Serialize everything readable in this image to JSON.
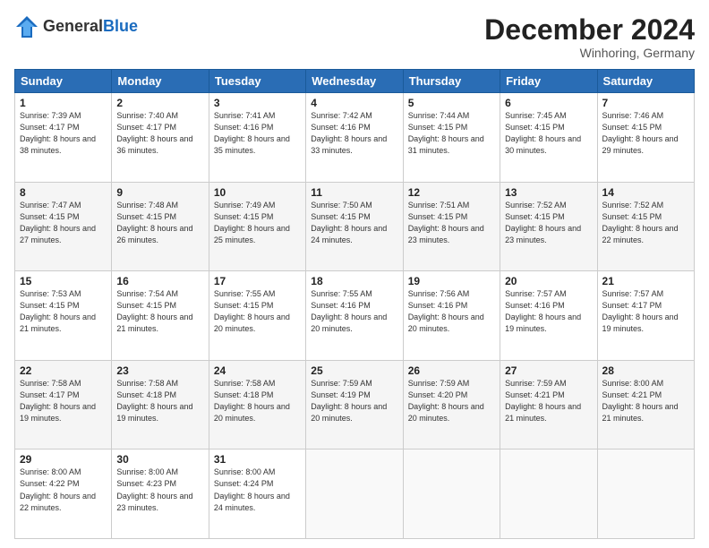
{
  "header": {
    "logo_general": "General",
    "logo_blue": "Blue",
    "month_title": "December 2024",
    "location": "Winhoring, Germany"
  },
  "weekdays": [
    "Sunday",
    "Monday",
    "Tuesday",
    "Wednesday",
    "Thursday",
    "Friday",
    "Saturday"
  ],
  "weeks": [
    [
      {
        "day": "1",
        "sunrise": "Sunrise: 7:39 AM",
        "sunset": "Sunset: 4:17 PM",
        "daylight": "Daylight: 8 hours and 38 minutes."
      },
      {
        "day": "2",
        "sunrise": "Sunrise: 7:40 AM",
        "sunset": "Sunset: 4:17 PM",
        "daylight": "Daylight: 8 hours and 36 minutes."
      },
      {
        "day": "3",
        "sunrise": "Sunrise: 7:41 AM",
        "sunset": "Sunset: 4:16 PM",
        "daylight": "Daylight: 8 hours and 35 minutes."
      },
      {
        "day": "4",
        "sunrise": "Sunrise: 7:42 AM",
        "sunset": "Sunset: 4:16 PM",
        "daylight": "Daylight: 8 hours and 33 minutes."
      },
      {
        "day": "5",
        "sunrise": "Sunrise: 7:44 AM",
        "sunset": "Sunset: 4:15 PM",
        "daylight": "Daylight: 8 hours and 31 minutes."
      },
      {
        "day": "6",
        "sunrise": "Sunrise: 7:45 AM",
        "sunset": "Sunset: 4:15 PM",
        "daylight": "Daylight: 8 hours and 30 minutes."
      },
      {
        "day": "7",
        "sunrise": "Sunrise: 7:46 AM",
        "sunset": "Sunset: 4:15 PM",
        "daylight": "Daylight: 8 hours and 29 minutes."
      }
    ],
    [
      {
        "day": "8",
        "sunrise": "Sunrise: 7:47 AM",
        "sunset": "Sunset: 4:15 PM",
        "daylight": "Daylight: 8 hours and 27 minutes."
      },
      {
        "day": "9",
        "sunrise": "Sunrise: 7:48 AM",
        "sunset": "Sunset: 4:15 PM",
        "daylight": "Daylight: 8 hours and 26 minutes."
      },
      {
        "day": "10",
        "sunrise": "Sunrise: 7:49 AM",
        "sunset": "Sunset: 4:15 PM",
        "daylight": "Daylight: 8 hours and 25 minutes."
      },
      {
        "day": "11",
        "sunrise": "Sunrise: 7:50 AM",
        "sunset": "Sunset: 4:15 PM",
        "daylight": "Daylight: 8 hours and 24 minutes."
      },
      {
        "day": "12",
        "sunrise": "Sunrise: 7:51 AM",
        "sunset": "Sunset: 4:15 PM",
        "daylight": "Daylight: 8 hours and 23 minutes."
      },
      {
        "day": "13",
        "sunrise": "Sunrise: 7:52 AM",
        "sunset": "Sunset: 4:15 PM",
        "daylight": "Daylight: 8 hours and 23 minutes."
      },
      {
        "day": "14",
        "sunrise": "Sunrise: 7:52 AM",
        "sunset": "Sunset: 4:15 PM",
        "daylight": "Daylight: 8 hours and 22 minutes."
      }
    ],
    [
      {
        "day": "15",
        "sunrise": "Sunrise: 7:53 AM",
        "sunset": "Sunset: 4:15 PM",
        "daylight": "Daylight: 8 hours and 21 minutes."
      },
      {
        "day": "16",
        "sunrise": "Sunrise: 7:54 AM",
        "sunset": "Sunset: 4:15 PM",
        "daylight": "Daylight: 8 hours and 21 minutes."
      },
      {
        "day": "17",
        "sunrise": "Sunrise: 7:55 AM",
        "sunset": "Sunset: 4:15 PM",
        "daylight": "Daylight: 8 hours and 20 minutes."
      },
      {
        "day": "18",
        "sunrise": "Sunrise: 7:55 AM",
        "sunset": "Sunset: 4:16 PM",
        "daylight": "Daylight: 8 hours and 20 minutes."
      },
      {
        "day": "19",
        "sunrise": "Sunrise: 7:56 AM",
        "sunset": "Sunset: 4:16 PM",
        "daylight": "Daylight: 8 hours and 20 minutes."
      },
      {
        "day": "20",
        "sunrise": "Sunrise: 7:57 AM",
        "sunset": "Sunset: 4:16 PM",
        "daylight": "Daylight: 8 hours and 19 minutes."
      },
      {
        "day": "21",
        "sunrise": "Sunrise: 7:57 AM",
        "sunset": "Sunset: 4:17 PM",
        "daylight": "Daylight: 8 hours and 19 minutes."
      }
    ],
    [
      {
        "day": "22",
        "sunrise": "Sunrise: 7:58 AM",
        "sunset": "Sunset: 4:17 PM",
        "daylight": "Daylight: 8 hours and 19 minutes."
      },
      {
        "day": "23",
        "sunrise": "Sunrise: 7:58 AM",
        "sunset": "Sunset: 4:18 PM",
        "daylight": "Daylight: 8 hours and 19 minutes."
      },
      {
        "day": "24",
        "sunrise": "Sunrise: 7:58 AM",
        "sunset": "Sunset: 4:18 PM",
        "daylight": "Daylight: 8 hours and 20 minutes."
      },
      {
        "day": "25",
        "sunrise": "Sunrise: 7:59 AM",
        "sunset": "Sunset: 4:19 PM",
        "daylight": "Daylight: 8 hours and 20 minutes."
      },
      {
        "day": "26",
        "sunrise": "Sunrise: 7:59 AM",
        "sunset": "Sunset: 4:20 PM",
        "daylight": "Daylight: 8 hours and 20 minutes."
      },
      {
        "day": "27",
        "sunrise": "Sunrise: 7:59 AM",
        "sunset": "Sunset: 4:21 PM",
        "daylight": "Daylight: 8 hours and 21 minutes."
      },
      {
        "day": "28",
        "sunrise": "Sunrise: 8:00 AM",
        "sunset": "Sunset: 4:21 PM",
        "daylight": "Daylight: 8 hours and 21 minutes."
      }
    ],
    [
      {
        "day": "29",
        "sunrise": "Sunrise: 8:00 AM",
        "sunset": "Sunset: 4:22 PM",
        "daylight": "Daylight: 8 hours and 22 minutes."
      },
      {
        "day": "30",
        "sunrise": "Sunrise: 8:00 AM",
        "sunset": "Sunset: 4:23 PM",
        "daylight": "Daylight: 8 hours and 23 minutes."
      },
      {
        "day": "31",
        "sunrise": "Sunrise: 8:00 AM",
        "sunset": "Sunset: 4:24 PM",
        "daylight": "Daylight: 8 hours and 24 minutes."
      },
      null,
      null,
      null,
      null
    ]
  ]
}
